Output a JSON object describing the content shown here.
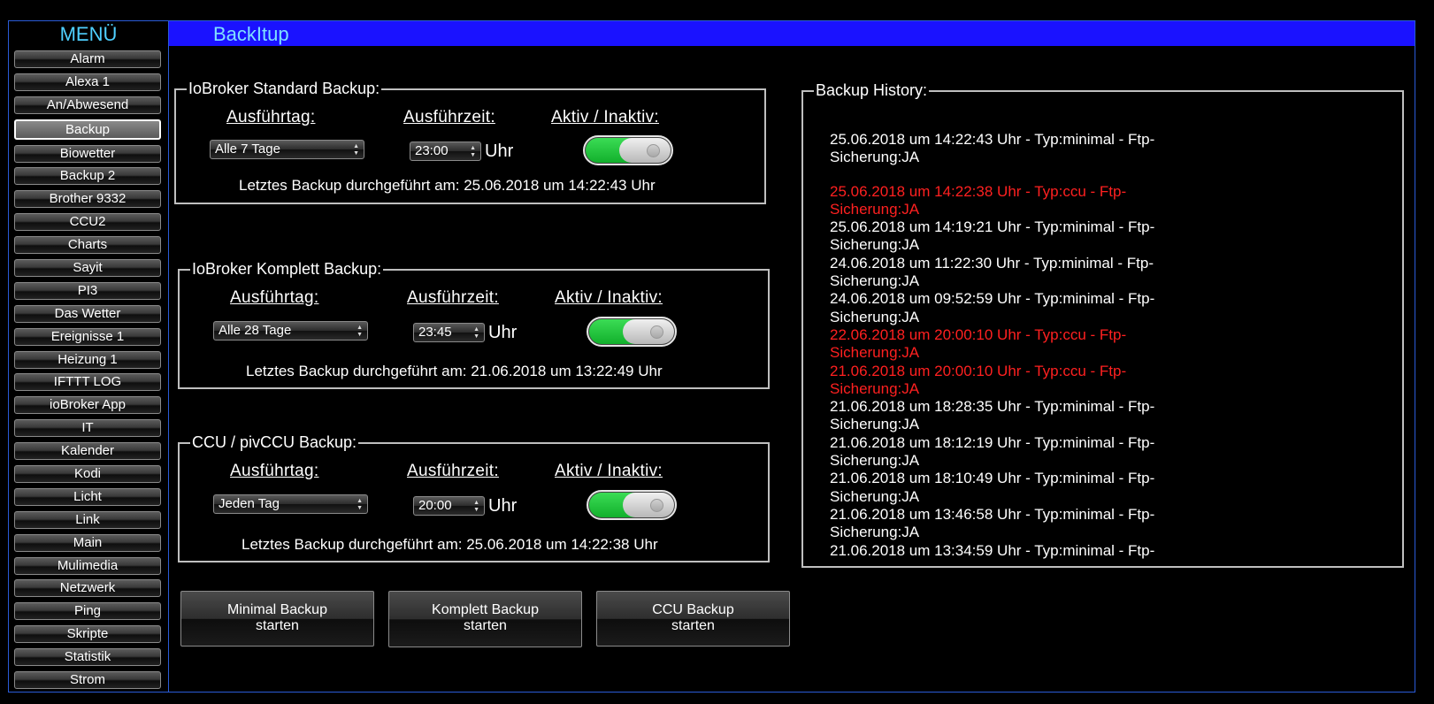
{
  "sidebar": {
    "title": "MENÜ",
    "items": [
      "Alarm",
      "Alexa 1",
      "An/Abwesend",
      "Backup",
      "Biowetter",
      "Backup 2",
      "Brother 9332",
      "CCU2",
      "Charts",
      "Sayit",
      "PI3",
      "Das Wetter",
      "Ereignisse 1",
      "Heizung 1",
      "IFTTT LOG",
      "ioBroker App",
      "IT",
      "Kalender",
      "Kodi",
      "Licht",
      "Link",
      "Main",
      "Mulimedia",
      "Netzwerk",
      "Ping",
      "Skripte",
      "Statistik",
      "Strom"
    ],
    "active": "Backup"
  },
  "header": {
    "title": "BackItup"
  },
  "groups": [
    {
      "legend": "IoBroker Standard Backup:",
      "day_label": "Ausführtag:",
      "time_label": "Ausführzeit:",
      "active_label": "Aktiv / Inaktiv:",
      "day_value": "Alle 7 Tage",
      "time_value": "23:00",
      "unit": "Uhr",
      "enabled": true,
      "last_backup": "Letztes Backup durchgeführt am: 25.06.2018 um 14:22:43 Uhr"
    },
    {
      "legend": "IoBroker Komplett Backup:",
      "day_label": "Ausführtag:",
      "time_label": "Ausführzeit:",
      "active_label": "Aktiv / Inaktiv:",
      "day_value": "Alle 28 Tage",
      "time_value": "23:45",
      "unit": "Uhr",
      "enabled": true,
      "last_backup": "Letztes Backup durchgeführt am: 21.06.2018 um 13:22:49 Uhr"
    },
    {
      "legend": "CCU / pivCCU Backup:",
      "day_label": "Ausführtag:",
      "time_label": "Ausführzeit:",
      "active_label": "Aktiv / Inaktiv:",
      "day_value": "Jeden Tag",
      "time_value": "20:00",
      "unit": "Uhr",
      "enabled": true,
      "last_backup": "Letztes Backup durchgeführt am: 25.06.2018 um 14:22:38 Uhr"
    }
  ],
  "history": {
    "legend": "Backup History:",
    "entries": [
      {
        "line1": "25.06.2018 um 14:22:43 Uhr - Typ:minimal - Ftp-",
        "line2": "Sicherung:JA",
        "color": "#ffffff"
      },
      {
        "line1": "25.06.2018 um 14:22:38 Uhr - Typ:ccu - Ftp-",
        "line2": "Sicherung:JA",
        "color": "#ff2020"
      },
      {
        "line1": "25.06.2018 um 14:19:21 Uhr - Typ:minimal - Ftp-",
        "line2": "Sicherung:JA",
        "color": "#ffffff"
      },
      {
        "line1": "24.06.2018 um 11:22:30 Uhr - Typ:minimal - Ftp-",
        "line2": "Sicherung:JA",
        "color": "#ffffff"
      },
      {
        "line1": "24.06.2018 um 09:52:59 Uhr - Typ:minimal - Ftp-",
        "line2": "Sicherung:JA",
        "color": "#ffffff"
      },
      {
        "line1": "22.06.2018 um 20:00:10 Uhr - Typ:ccu - Ftp-",
        "line2": "Sicherung:JA",
        "color": "#ff2020"
      },
      {
        "line1": "21.06.2018 um 20:00:10 Uhr - Typ:ccu - Ftp-",
        "line2": "Sicherung:JA",
        "color": "#ff2020"
      },
      {
        "line1": "21.06.2018 um 18:28:35 Uhr - Typ:minimal - Ftp-",
        "line2": "Sicherung:JA",
        "color": "#ffffff"
      },
      {
        "line1": "21.06.2018 um 18:12:19 Uhr - Typ:minimal - Ftp-",
        "line2": "Sicherung:JA",
        "color": "#ffffff"
      },
      {
        "line1": "21.06.2018 um 18:10:49 Uhr - Typ:minimal - Ftp-",
        "line2": "Sicherung:JA",
        "color": "#ffffff"
      },
      {
        "line1": "21.06.2018 um 13:46:58 Uhr - Typ:minimal - Ftp-",
        "line2": "Sicherung:JA",
        "color": "#ffffff"
      },
      {
        "line1": "21.06.2018 um 13:34:59 Uhr - Typ:minimal - Ftp-",
        "line2": "",
        "color": "#ffffff"
      }
    ]
  },
  "buttons": [
    {
      "line1": "Minimal Backup",
      "line2": "starten"
    },
    {
      "line1": "Komplett Backup",
      "line2": "starten"
    },
    {
      "line1": "CCU Backup",
      "line2": "starten"
    }
  ],
  "colors": {
    "header_bg": "#1a12ff",
    "title": "#4fd0ff",
    "toggle_on": "#12b02c",
    "history_alert": "#ff2020"
  },
  "icons": {
    "select_caret": "updown-caret-icon"
  }
}
